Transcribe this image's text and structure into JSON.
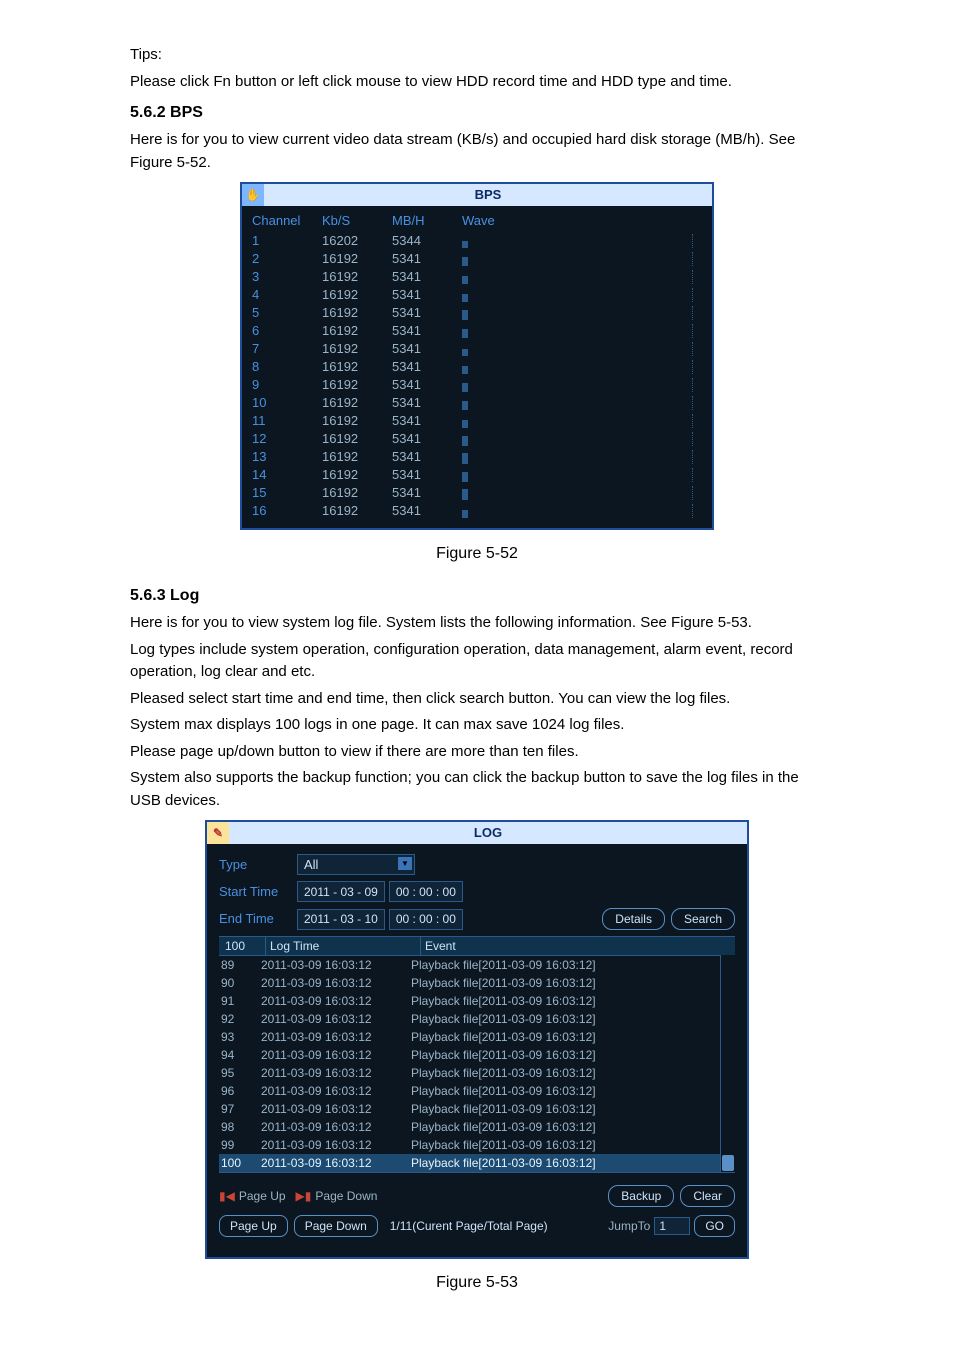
{
  "doc": {
    "tips_label": "Tips:",
    "tips_text": "Please click Fn button or left click mouse to view HDD record time and HDD type and time.",
    "sec1_heading": "5.6.2  BPS",
    "sec1_text": "Here is for you to view current video data stream (KB/s) and occupied hard disk storage (MB/h). See Figure 5-52.",
    "fig1_caption": "Figure 5-52",
    "sec2_heading": "5.6.3  Log",
    "sec2_p1": "Here is for you to view system log file. System lists the following information. See Figure 5-53.",
    "sec2_p2": "Log types include system operation, configuration operation, data management, alarm event, record operation, log clear and etc.",
    "sec2_p3": "Pleased select start time and end time, then click search button. You can view the log files.",
    "sec2_p4": "System max displays 100 logs in one page. It can max save 1024 log files.",
    "sec2_p5": "Please page up/down button to view if there are more than ten files.",
    "sec2_p6": "System also supports the backup function; you can click the backup button to save the log files in the USB devices.",
    "fig2_caption": "Figure 5-53"
  },
  "bps": {
    "title": "BPS",
    "headers": {
      "ch": "Channel",
      "kbs": "Kb/S",
      "mbh": "MB/H",
      "wave": "Wave"
    },
    "rows": [
      {
        "ch": "1",
        "kbs": "16202",
        "mbh": "5344"
      },
      {
        "ch": "2",
        "kbs": "16192",
        "mbh": "5341"
      },
      {
        "ch": "3",
        "kbs": "16192",
        "mbh": "5341"
      },
      {
        "ch": "4",
        "kbs": "16192",
        "mbh": "5341"
      },
      {
        "ch": "5",
        "kbs": "16192",
        "mbh": "5341"
      },
      {
        "ch": "6",
        "kbs": "16192",
        "mbh": "5341"
      },
      {
        "ch": "7",
        "kbs": "16192",
        "mbh": "5341"
      },
      {
        "ch": "8",
        "kbs": "16192",
        "mbh": "5341"
      },
      {
        "ch": "9",
        "kbs": "16192",
        "mbh": "5341"
      },
      {
        "ch": "10",
        "kbs": "16192",
        "mbh": "5341"
      },
      {
        "ch": "11",
        "kbs": "16192",
        "mbh": "5341"
      },
      {
        "ch": "12",
        "kbs": "16192",
        "mbh": "5341"
      },
      {
        "ch": "13",
        "kbs": "16192",
        "mbh": "5341"
      },
      {
        "ch": "14",
        "kbs": "16192",
        "mbh": "5341"
      },
      {
        "ch": "15",
        "kbs": "16192",
        "mbh": "5341"
      },
      {
        "ch": "16",
        "kbs": "16192",
        "mbh": "5341"
      }
    ]
  },
  "log": {
    "title": "LOG",
    "labels": {
      "type": "Type",
      "start": "Start Time",
      "end": "End Time",
      "details": "Details",
      "search": "Search",
      "backup": "Backup",
      "clear": "Clear",
      "pageup_label": "Page Up",
      "pagedown_label": "Page Down",
      "pageup_btn": "Page Up",
      "pagedown_btn": "Page Down",
      "pageinfo": "1/11(Curent Page/Total Page)",
      "jumpto": "JumpTo",
      "go": "GO"
    },
    "type_selected": "All",
    "start_date": "2011  -  03  -  09",
    "start_time": "00 : 00 : 00",
    "end_date": "2011  -  03  -  10",
    "end_time": "00 : 00 : 00",
    "count": "100",
    "headers": {
      "time": "Log Time",
      "event": "Event"
    },
    "rows": [
      {
        "idx": "89",
        "time": "2011-03-09 16:03:12",
        "event": "Playback file[2011-03-09 16:03:12]"
      },
      {
        "idx": "90",
        "time": "2011-03-09 16:03:12",
        "event": "Playback file[2011-03-09 16:03:12]"
      },
      {
        "idx": "91",
        "time": "2011-03-09 16:03:12",
        "event": "Playback file[2011-03-09 16:03:12]"
      },
      {
        "idx": "92",
        "time": "2011-03-09 16:03:12",
        "event": "Playback file[2011-03-09 16:03:12]"
      },
      {
        "idx": "93",
        "time": "2011-03-09 16:03:12",
        "event": "Playback file[2011-03-09 16:03:12]"
      },
      {
        "idx": "94",
        "time": "2011-03-09 16:03:12",
        "event": "Playback file[2011-03-09 16:03:12]"
      },
      {
        "idx": "95",
        "time": "2011-03-09 16:03:12",
        "event": "Playback file[2011-03-09 16:03:12]"
      },
      {
        "idx": "96",
        "time": "2011-03-09 16:03:12",
        "event": "Playback file[2011-03-09 16:03:12]"
      },
      {
        "idx": "97",
        "time": "2011-03-09 16:03:12",
        "event": "Playback file[2011-03-09 16:03:12]"
      },
      {
        "idx": "98",
        "time": "2011-03-09 16:03:12",
        "event": "Playback file[2011-03-09 16:03:12]"
      },
      {
        "idx": "99",
        "time": "2011-03-09 16:03:12",
        "event": "Playback file[2011-03-09 16:03:12]"
      },
      {
        "idx": "100",
        "time": "2011-03-09 16:03:12",
        "event": "Playback file[2011-03-09 16:03:12]"
      }
    ],
    "jump_value": "1"
  }
}
